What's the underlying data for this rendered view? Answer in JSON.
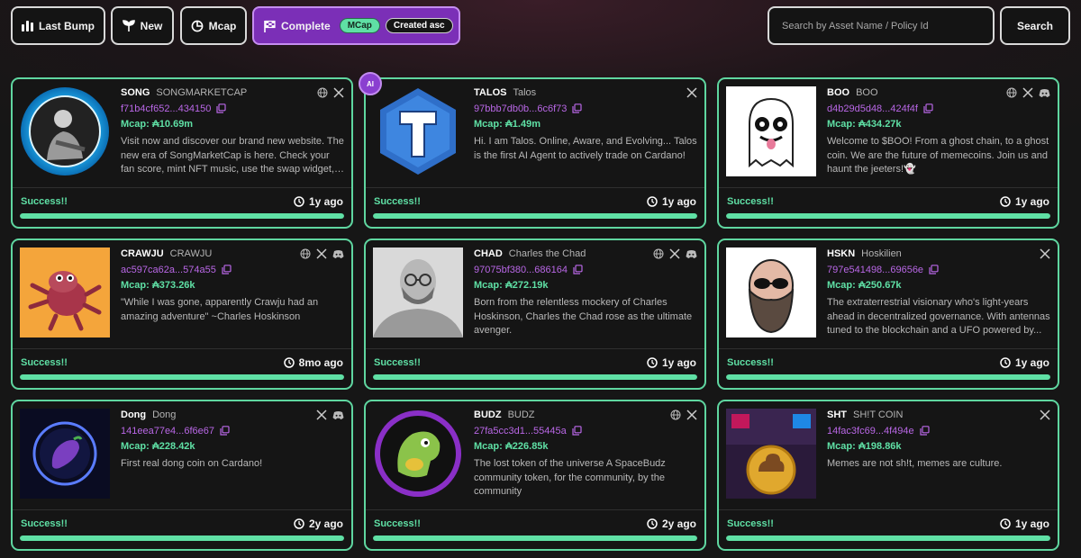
{
  "toolbar": {
    "last_bump": "Last Bump",
    "new": "New",
    "mcap": "Mcap",
    "complete": "Complete",
    "complete_sort_field": "MCap",
    "complete_sort_order": "Created asc",
    "search_placeholder": "Search by Asset Name / Policy Id",
    "search_button": "Search"
  },
  "colors": {
    "accent_green": "#5fe0a5",
    "accent_purple": "#7b2fb7",
    "policy_purple": "#b967e6"
  },
  "cards": [
    {
      "ticker": "SONG",
      "name": "SONGMARKETCAP",
      "policy": "f71b4cf652...434150",
      "mcap": "Mcap: ₳10.69m",
      "description": "Visit now and discover our brand new website. The new era of SongMarketCap is here. Check your fan score, mint NFT music, use the swap widget, and...",
      "status": "Success!!",
      "age": "1y ago",
      "progress": 1.0,
      "socials": [
        "globe-icon",
        "x-icon"
      ]
    },
    {
      "ticker": "TALOS",
      "name": "Talos",
      "policy": "97bbb7db0b...6c6f73",
      "mcap": "Mcap: ₳1.49m",
      "description": "Hi. I am Talos. Online, Aware, and Evolving... Talos is the first AI Agent to actively trade on Cardano!",
      "status": "Success!!",
      "age": "1y ago",
      "progress": 1.0,
      "socials": [
        "x-icon"
      ],
      "badge": "AI"
    },
    {
      "ticker": "BOO",
      "name": "BOO",
      "policy": "d4b29d5d48...424f4f",
      "mcap": "Mcap: ₳434.27k",
      "description": "Welcome to $BOO! From a ghost chain, to a ghost coin. We are the future of memecoins. Join us and haunt the jeeters!👻",
      "status": "Success!!",
      "age": "1y ago",
      "progress": 1.0,
      "socials": [
        "globe-icon",
        "x-icon",
        "discord-icon"
      ]
    },
    {
      "ticker": "CRAWJU",
      "name": "CRAWJU",
      "policy": "ac597ca62a...574a55",
      "mcap": "Mcap: ₳373.26k",
      "description": "\"While I was gone, apparently Crawju had an amazing adventure\" ~Charles Hoskinson",
      "status": "Success!!",
      "age": "8mo ago",
      "progress": 1.0,
      "socials": [
        "globe-icon",
        "x-icon",
        "discord-icon"
      ]
    },
    {
      "ticker": "CHAD",
      "name": "Charles the Chad",
      "policy": "97075bf380...686164",
      "mcap": "Mcap: ₳272.19k",
      "description": "Born from the relentless mockery of Charles Hoskinson, Charles the Chad rose as the ultimate avenger.",
      "status": "Success!!",
      "age": "1y ago",
      "progress": 1.0,
      "socials": [
        "globe-icon",
        "x-icon",
        "discord-icon"
      ]
    },
    {
      "ticker": "HSKN",
      "name": "Hoskilien",
      "policy": "797e541498...69656e",
      "mcap": "Mcap: ₳250.67k",
      "description": "The extraterrestrial visionary who's light-years ahead in decentralized governance. With antennas tuned to the blockchain and a UFO powered by...",
      "status": "Success!!",
      "age": "1y ago",
      "progress": 1.0,
      "socials": [
        "x-icon"
      ]
    },
    {
      "ticker": "Dong",
      "name": "Dong",
      "policy": "141eea77e4...6f6e67",
      "mcap": "Mcap: ₳228.42k",
      "description": "First real dong coin on Cardano!",
      "status": "Success!!",
      "age": "2y ago",
      "progress": 1.0,
      "socials": [
        "x-icon",
        "discord-icon"
      ]
    },
    {
      "ticker": "BUDZ",
      "name": "BUDZ",
      "policy": "27fa5cc3d1...55445a",
      "mcap": "Mcap: ₳226.85k",
      "description": "The lost token of the universe A SpaceBudz community token, for the community, by the community",
      "status": "Success!!",
      "age": "2y ago",
      "progress": 1.0,
      "socials": [
        "globe-icon",
        "x-icon"
      ]
    },
    {
      "ticker": "SHT",
      "name": "SH!T COIN",
      "policy": "14fac3fc69...4f494e",
      "mcap": "Mcap: ₳198.86k",
      "description": "Memes are not sh!t, memes are culture.",
      "status": "Success!!",
      "age": "1y ago",
      "progress": 1.0,
      "socials": [
        "x-icon"
      ]
    }
  ]
}
